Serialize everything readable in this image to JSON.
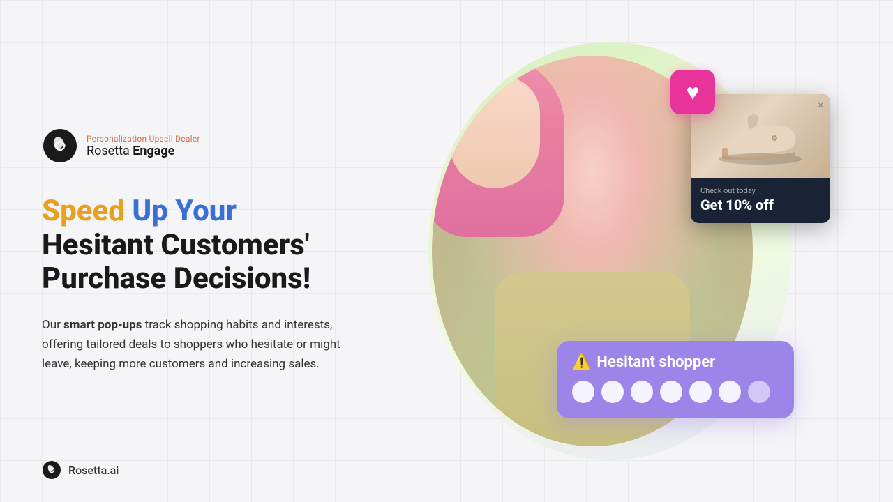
{
  "brand": {
    "tagline": "Personalization Upsell Dealer",
    "name_plain": "Rosetta",
    "name_bold": "Engage",
    "bottom_logo_text": "Rosetta.ai"
  },
  "headline": {
    "word_colored": "Speed",
    "word_blue": "Up Your",
    "rest": "Hesitant Customers'\nPurchase Decisions!"
  },
  "description": {
    "prefix": "Our ",
    "bold_text": "smart pop-ups",
    "suffix": " track shopping habits and interests, offering tailored deals to shoppers who hesitate or might leave, keeping more customers and increasing sales."
  },
  "popup_discount": {
    "close_label": "×",
    "check_out": "Check out today",
    "discount_text": "Get 10% off"
  },
  "hesitant_card": {
    "warning_emoji": "⚠️",
    "label": "Hesitant shopper",
    "dots": [
      {
        "active": true
      },
      {
        "active": true
      },
      {
        "active": true
      },
      {
        "active": true
      },
      {
        "active": true
      },
      {
        "active": true
      },
      {
        "active": false,
        "last": true
      }
    ]
  },
  "colors": {
    "speed_color": "#e8a020",
    "blue_color": "#3a6fd4",
    "heart_bg": "#e8339a",
    "card_bg": "#9b85e8",
    "popup_bg": "#1a2236",
    "tagline_color": "#d4704a"
  }
}
